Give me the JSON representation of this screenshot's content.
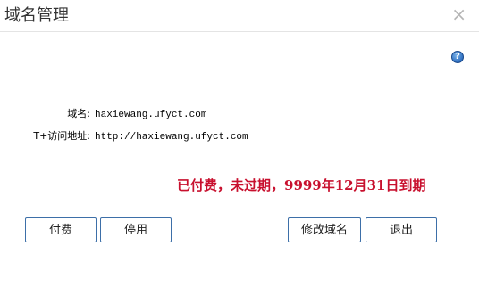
{
  "dialog": {
    "title": "域名管理",
    "close_glyph": "×",
    "help_glyph": "?"
  },
  "info": {
    "domain_label": "域名:",
    "domain_value": "haxiewang.ufyct.com",
    "url_label": "T+访问地址:",
    "url_value": "http://haxiewang.ufyct.com"
  },
  "status": {
    "text": "已付费，未过期，9999年12月31日到期",
    "color": "#c8102e"
  },
  "buttons": {
    "pay": "付费",
    "disable": "停用",
    "modify_domain": "修改域名",
    "exit": "退出"
  },
  "icons": [
    "close-icon",
    "help-icon"
  ]
}
